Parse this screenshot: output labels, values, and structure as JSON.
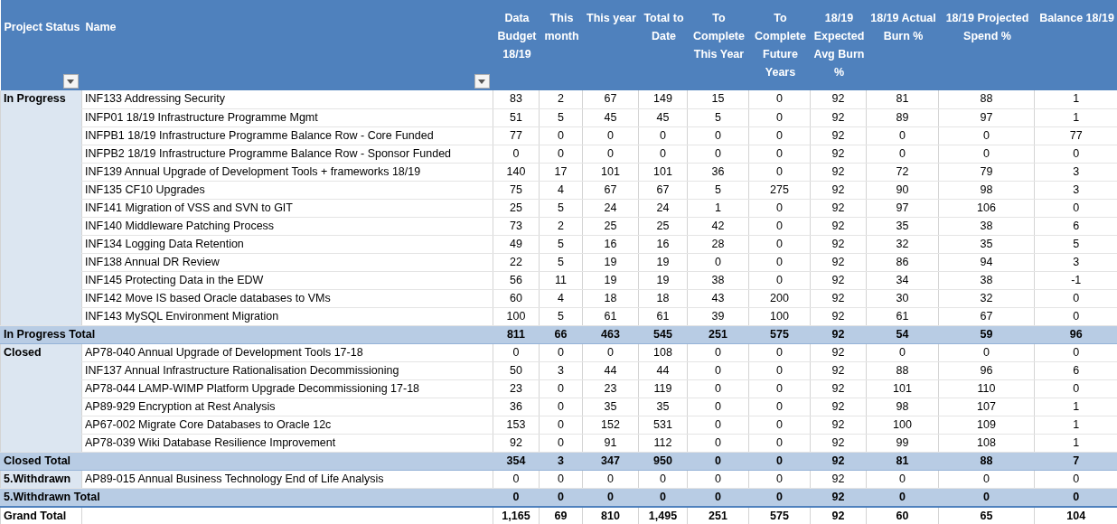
{
  "columns": [
    {
      "label": "Project Status",
      "filter": true
    },
    {
      "label": "Name",
      "filter": true
    },
    {
      "label": "Data Budget 18/19"
    },
    {
      "label": "This month"
    },
    {
      "label": "This year"
    },
    {
      "label": "Total to Date"
    },
    {
      "label": "To Complete This Year"
    },
    {
      "label": "To Complete Future Years"
    },
    {
      "label": "18/19 Expected Avg Burn %"
    },
    {
      "label": "18/19 Actual Burn %"
    },
    {
      "label": "18/19 Projected Spend %"
    },
    {
      "label": "Balance 18/19"
    }
  ],
  "groups": [
    {
      "status": "In Progress",
      "rows": [
        {
          "name": "INF133 Addressing Security",
          "values": [
            "83",
            "2",
            "67",
            "149",
            "15",
            "0",
            "92",
            "81",
            "88",
            "1"
          ]
        },
        {
          "name": "INFP01 18/19  Infrastructure Programme Mgmt",
          "values": [
            "51",
            "5",
            "45",
            "45",
            "5",
            "0",
            "92",
            "89",
            "97",
            "1"
          ]
        },
        {
          "name": "INFPB1 18/19 Infrastructure Programme Balance Row - Core Funded",
          "values": [
            "77",
            "0",
            "0",
            "0",
            "0",
            "0",
            "92",
            "0",
            "0",
            "77"
          ]
        },
        {
          "name": "INFPB2 18/19 Infrastructure Programme Balance Row - Sponsor Funded",
          "values": [
            "0",
            "0",
            "0",
            "0",
            "0",
            "0",
            "92",
            "0",
            "0",
            "0"
          ]
        },
        {
          "name": "INF139 Annual Upgrade of Development Tools + frameworks 18/19",
          "values": [
            "140",
            "17",
            "101",
            "101",
            "36",
            "0",
            "92",
            "72",
            "79",
            "3"
          ]
        },
        {
          "name": "INF135 CF10 Upgrades",
          "values": [
            "75",
            "4",
            "67",
            "67",
            "5",
            "275",
            "92",
            "90",
            "98",
            "3"
          ]
        },
        {
          "name": "INF141 Migration of VSS and SVN to GIT",
          "values": [
            "25",
            "5",
            "24",
            "24",
            "1",
            "0",
            "92",
            "97",
            "106",
            "0"
          ]
        },
        {
          "name": "INF140 Middleware Patching Process",
          "values": [
            "73",
            "2",
            "25",
            "25",
            "42",
            "0",
            "92",
            "35",
            "38",
            "6"
          ]
        },
        {
          "name": "INF134 Logging Data Retention",
          "values": [
            "49",
            "5",
            "16",
            "16",
            "28",
            "0",
            "92",
            "32",
            "35",
            "5"
          ]
        },
        {
          "name": "INF138 Annual DR Review",
          "values": [
            "22",
            "5",
            "19",
            "19",
            "0",
            "0",
            "92",
            "86",
            "94",
            "3"
          ]
        },
        {
          "name": "INF145 Protecting Data in the EDW",
          "values": [
            "56",
            "11",
            "19",
            "19",
            "38",
            "0",
            "92",
            "34",
            "38",
            "-1"
          ]
        },
        {
          "name": "INF142 Move IS based Oracle databases to VMs",
          "values": [
            "60",
            "4",
            "18",
            "18",
            "43",
            "200",
            "92",
            "30",
            "32",
            "0"
          ]
        },
        {
          "name": "INF143 MySQL Environment Migration",
          "values": [
            "100",
            "5",
            "61",
            "61",
            "39",
            "100",
            "92",
            "61",
            "67",
            "0"
          ]
        }
      ],
      "total": {
        "label": "In Progress Total",
        "values": [
          "811",
          "66",
          "463",
          "545",
          "251",
          "575",
          "92",
          "54",
          "59",
          "96"
        ]
      }
    },
    {
      "status": "Closed",
      "rows": [
        {
          "name": "AP78-040 Annual Upgrade of Development Tools 17-18",
          "values": [
            "0",
            "0",
            "0",
            "108",
            "0",
            "0",
            "92",
            "0",
            "0",
            "0"
          ]
        },
        {
          "name": "INF137  Annual Infrastructure Rationalisation Decommissioning",
          "values": [
            "50",
            "3",
            "44",
            "44",
            "0",
            "0",
            "92",
            "88",
            "96",
            "6"
          ]
        },
        {
          "name": "AP78-044 LAMP-WIMP Platform Upgrade Decommissioning 17-18",
          "values": [
            "23",
            "0",
            "23",
            "119",
            "0",
            "0",
            "92",
            "101",
            "110",
            "0"
          ]
        },
        {
          "name": "AP89-929 Encryption at Rest Analysis",
          "values": [
            "36",
            "0",
            "35",
            "35",
            "0",
            "0",
            "92",
            "98",
            "107",
            "1"
          ]
        },
        {
          "name": "AP67-002 Migrate Core Databases to Oracle 12c",
          "values": [
            "153",
            "0",
            "152",
            "531",
            "0",
            "0",
            "92",
            "100",
            "109",
            "1"
          ]
        },
        {
          "name": "AP78-039 Wiki Database Resilience Improvement",
          "values": [
            "92",
            "0",
            "91",
            "112",
            "0",
            "0",
            "92",
            "99",
            "108",
            "1"
          ]
        }
      ],
      "total": {
        "label": "Closed Total",
        "values": [
          "354",
          "3",
          "347",
          "950",
          "0",
          "0",
          "92",
          "81",
          "88",
          "7"
        ]
      }
    },
    {
      "status": "5.Withdrawn",
      "rows": [
        {
          "name": "AP89-015 Annual Business Technology End of Life Analysis",
          "values": [
            "0",
            "0",
            "0",
            "0",
            "0",
            "0",
            "92",
            "0",
            "0",
            "0"
          ]
        }
      ],
      "total": {
        "label": "5.Withdrawn Total",
        "values": [
          "0",
          "0",
          "0",
          "0",
          "0",
          "0",
          "92",
          "0",
          "0",
          "0"
        ]
      }
    }
  ],
  "grand_total": {
    "label": "Grand Total",
    "values": [
      "1,165",
      "69",
      "810",
      "1,495",
      "251",
      "575",
      "92",
      "60",
      "65",
      "104"
    ]
  }
}
